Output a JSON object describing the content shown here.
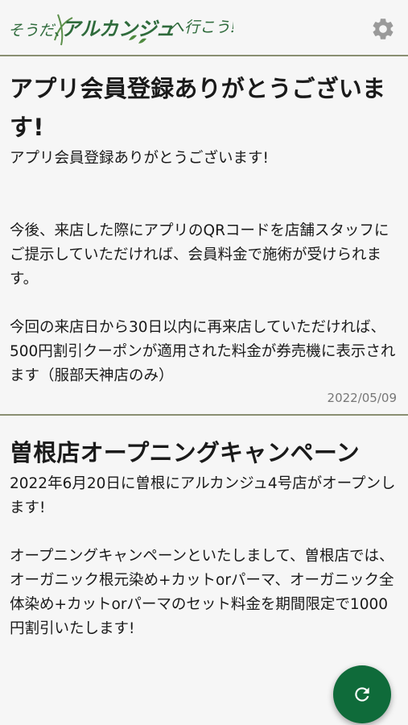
{
  "header": {
    "logo_text": "そうだ、アルカンジュへ行こう!",
    "logo_color": "#2f6b3c"
  },
  "articles": [
    {
      "title": "アプリ会員登録ありがとうございます!",
      "body": "アプリ会員登録ありがとうございます!\n\n\n今後、来店した際にアプリのQRコードを店舗スタッフにご提示していただければ、会員料金で施術が受けられます。\n\n今回の来店日から30日以内に再来店していただければ、500円割引クーポンが適用された料金が券売機に表示されます（服部天神店のみ）",
      "date": "2022/05/09"
    },
    {
      "title": "曽根店オープニングキャンペーン",
      "body": "2022年6月20日に曽根にアルカンジュ4号店がオープンします!\n\nオープニングキャンペーンといたしまして、曽根店では、オーガニック根元染め+カットorパーマ、オーガニック全体染め+カットorパーマのセット料金を期間限定で1000円割引いたします!"
    }
  ],
  "icons": {
    "settings": "gear-icon",
    "refresh": "refresh-icon"
  },
  "colors": {
    "accent": "#0f6b3a",
    "divider": "#8a8f72",
    "background": "#f6f6f6"
  }
}
